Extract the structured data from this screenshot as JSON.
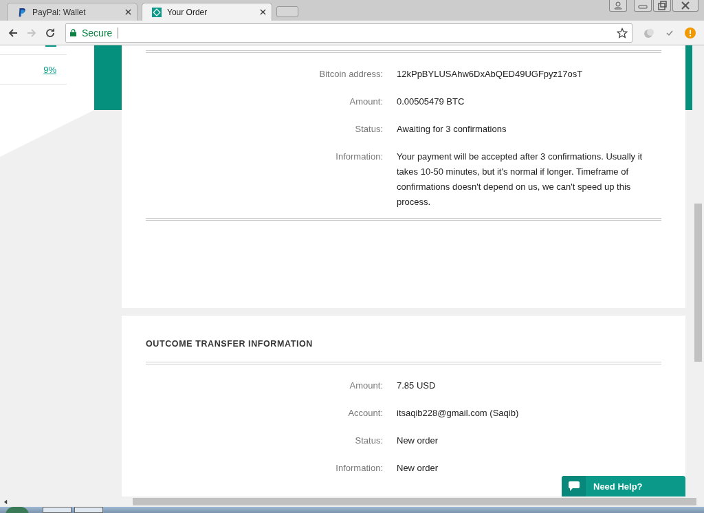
{
  "tabs": [
    {
      "title": "PayPal: Wallet",
      "selected": false
    },
    {
      "title": "Your Order",
      "selected": true
    }
  ],
  "address_bar": {
    "security": "Secure"
  },
  "side_panel": {
    "link": "9%"
  },
  "payment_details": {
    "rows": [
      {
        "label": "Bitcoin address:",
        "value": "12kPpBYLUSAhw6DxAbQED49UGFpyz17osT"
      },
      {
        "label": "Amount:",
        "value": "0.00505479 BTC"
      },
      {
        "label": "Status:",
        "value": "Awaiting for 3 confirmations"
      },
      {
        "label": "Information:",
        "value": "Your payment will be accepted after 3 confirmations. Usually it takes 10-50 minutes, but it's normal if longer. Timeframe of confirmations doesn't depend on us, we can't speed up this process."
      }
    ]
  },
  "outcome_transfer": {
    "title": "OUTCOME TRANSFER INFORMATION",
    "rows": [
      {
        "label": "Amount:",
        "value": "7.85 USD"
      },
      {
        "label": "Account:",
        "value": "itsaqib228@gmail.com (Saqib)"
      },
      {
        "label": "Status:",
        "value": "New order"
      },
      {
        "label": "Information:",
        "value": "New order"
      }
    ]
  },
  "help_button": {
    "label": "Need Help?"
  }
}
